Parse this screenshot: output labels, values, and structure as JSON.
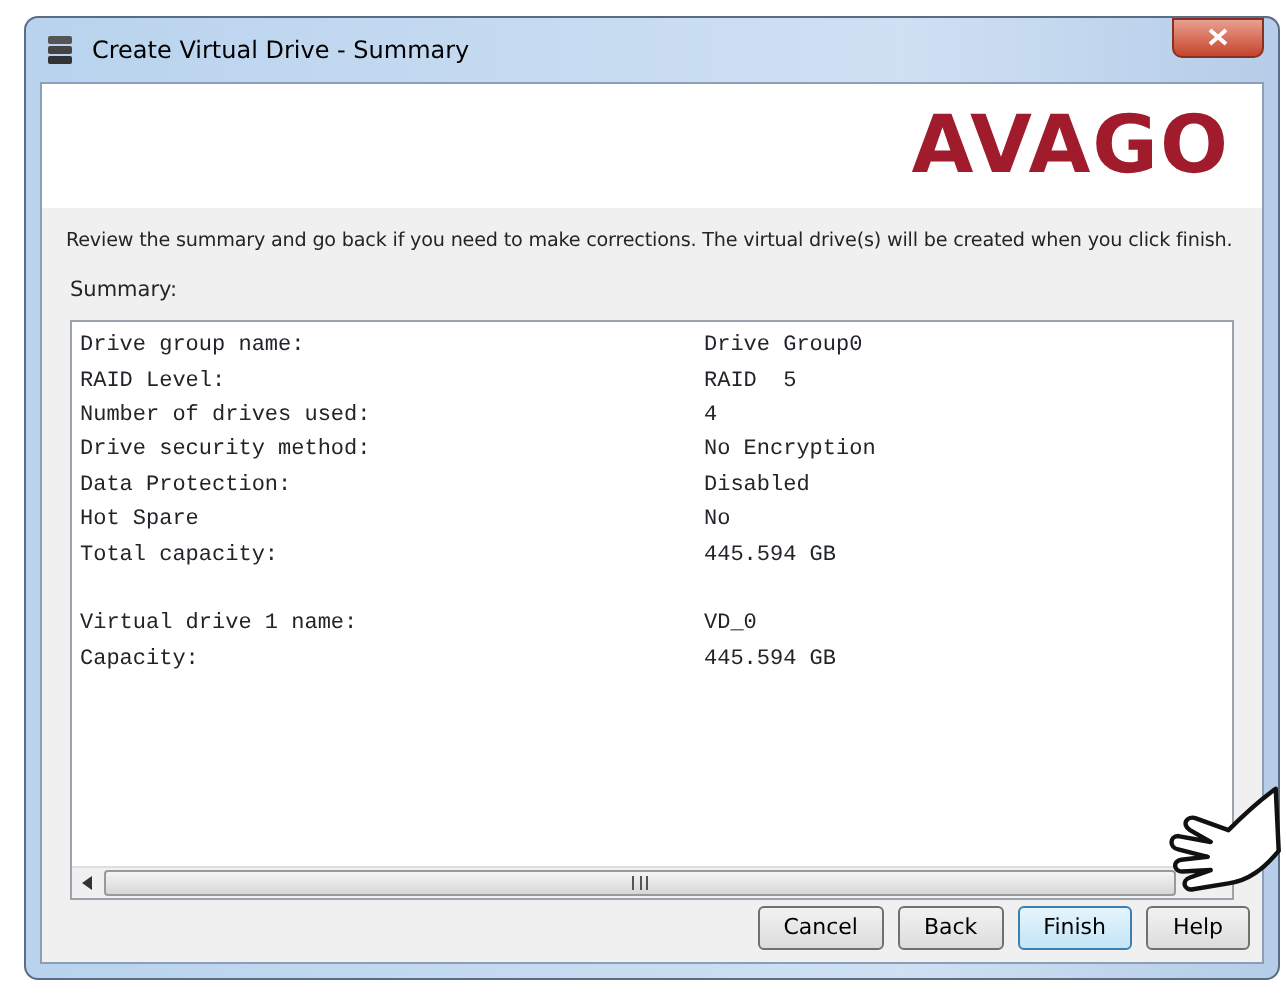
{
  "window": {
    "title": "Create Virtual Drive - Summary"
  },
  "banner": {
    "logo": "AVAGO"
  },
  "instructions": "Review the summary and go back if you need to make corrections. The virtual drive(s) will be created when you click finish.",
  "summary_label": "Summary:",
  "summary_groups": [
    {
      "rows": [
        {
          "label": "Drive group name:",
          "value": "Drive Group0"
        },
        {
          "label": "RAID Level:",
          "value": "RAID  5"
        },
        {
          "label": "Number of drives used:",
          "value": "4"
        },
        {
          "label": "Drive security method:",
          "value": "No Encryption"
        },
        {
          "label": "Data Protection:",
          "value": "Disabled"
        },
        {
          "label": "Hot Spare",
          "value": "No"
        },
        {
          "label": "Total capacity:",
          "value": "445.594 GB"
        }
      ]
    },
    {
      "rows": [
        {
          "label": "Virtual drive 1 name:",
          "value": "VD_0"
        },
        {
          "label": "Capacity:",
          "value": "445.594 GB"
        }
      ]
    }
  ],
  "buttons": [
    {
      "label": "Cancel",
      "selected": false
    },
    {
      "label": "Back",
      "selected": false
    },
    {
      "label": "Finish",
      "selected": true
    },
    {
      "label": "Help",
      "selected": false
    }
  ]
}
